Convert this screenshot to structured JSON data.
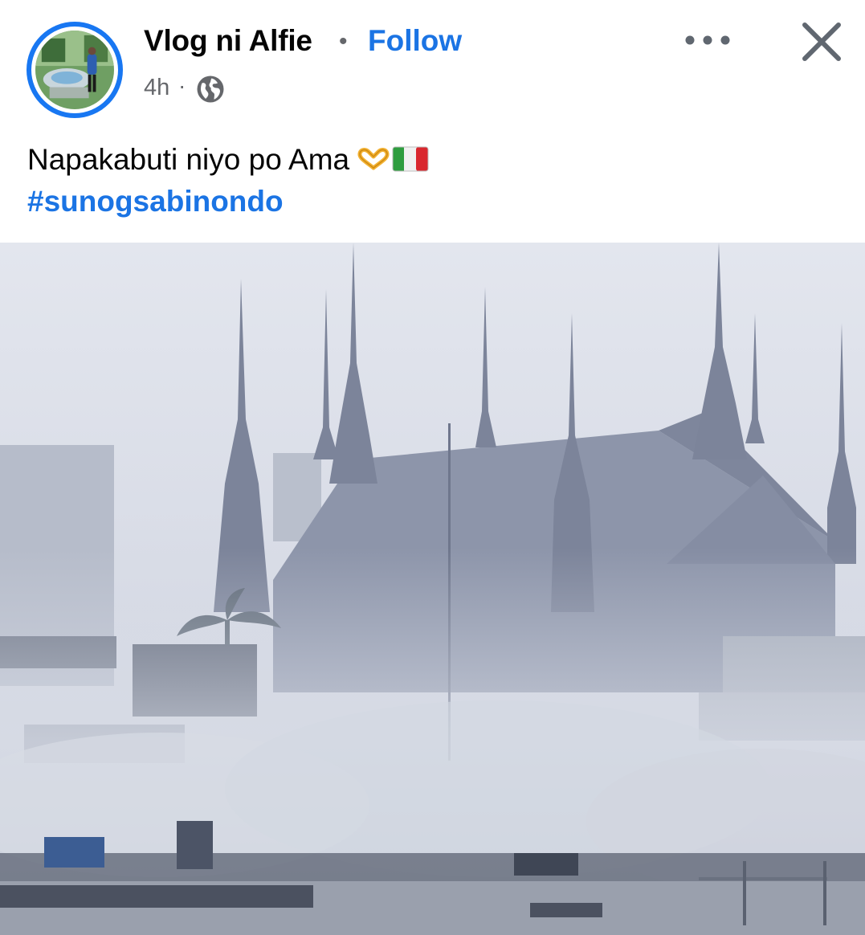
{
  "post": {
    "author": {
      "name": "Vlog ni Alfie",
      "avatar_icon": "profile-photo"
    },
    "separator": "•",
    "follow_label": "Follow",
    "timestamp": "4h",
    "time_separator": "·",
    "audience_icon": "globe-icon",
    "menu_icon": "more-horizontal-icon",
    "close_icon": "close-icon",
    "caption": {
      "text": "Napakabuti niyo po Ama",
      "emoji": [
        "heart-hands-emoji",
        "italy-flag-emoji"
      ]
    },
    "hashtag": "#sunogsabinondo",
    "photo_subject": "smoke-filled-scene-with-cathedral-spires"
  },
  "colors": {
    "link_blue": "#1b74e4",
    "avatar_ring": "#1877f2",
    "secondary_text": "#65676b",
    "primary_text": "#050505"
  }
}
